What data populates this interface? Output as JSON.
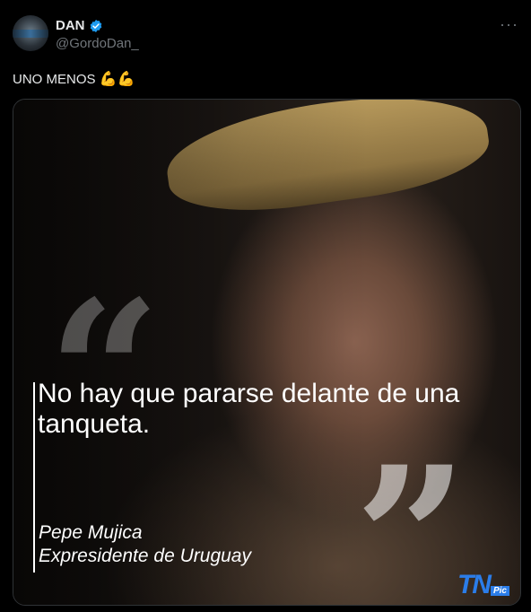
{
  "user": {
    "display_name": "DAN",
    "handle": "@GordoDan_",
    "verified_color": "#1d9bf0"
  },
  "tweet": {
    "text": "UNO MENOS",
    "emoji": "💪💪"
  },
  "menu": {
    "more_label": "···"
  },
  "media": {
    "quote": "No hay que pararse delante de una tanqueta.",
    "author_name": "Pepe Mujica",
    "author_title": "Expresidente de Uruguay",
    "logo_main": "TN",
    "logo_sub": "Pic",
    "open_quote": "“",
    "close_quote": "”"
  },
  "colors": {
    "background": "#000000",
    "muted_text": "#71767b",
    "brand_blue": "#2b7de9"
  }
}
